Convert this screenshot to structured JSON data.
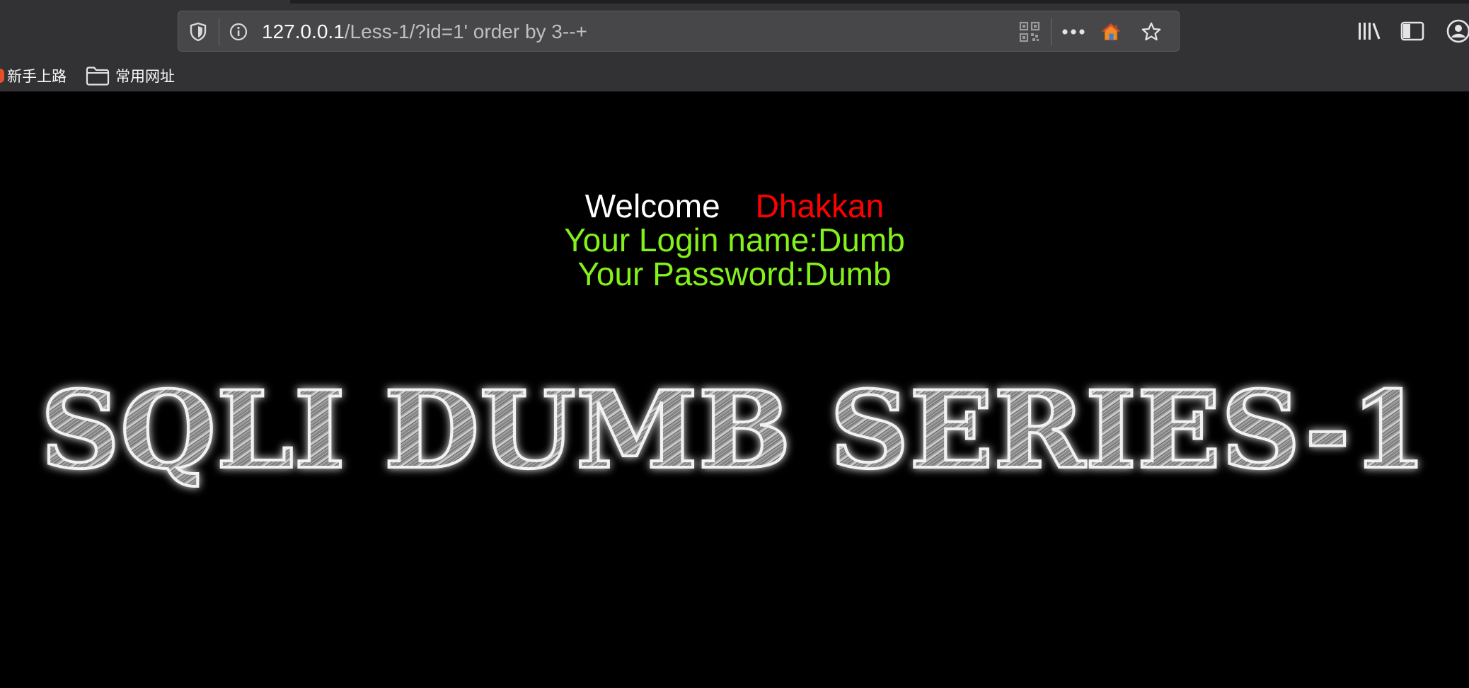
{
  "browser": {
    "url_host": "127.0.0.1",
    "url_path": "/Less-1/?id=1' order by 3--+",
    "bookmarks": [
      {
        "label": "新手上路",
        "icon": "firefox-icon"
      },
      {
        "label": "常用网址",
        "icon": "folder-icon"
      }
    ]
  },
  "page": {
    "welcome": "Welcome",
    "username": "Dhakkan",
    "login_line": "Your Login name:Dumb",
    "password_line": "Your Password:Dumb",
    "banner_text": "SQLI DUMB SERIES-1"
  },
  "colors": {
    "background": "#000000",
    "welcome": "#ffffff",
    "username": "#ff0000",
    "credentials": "#83f11a"
  }
}
